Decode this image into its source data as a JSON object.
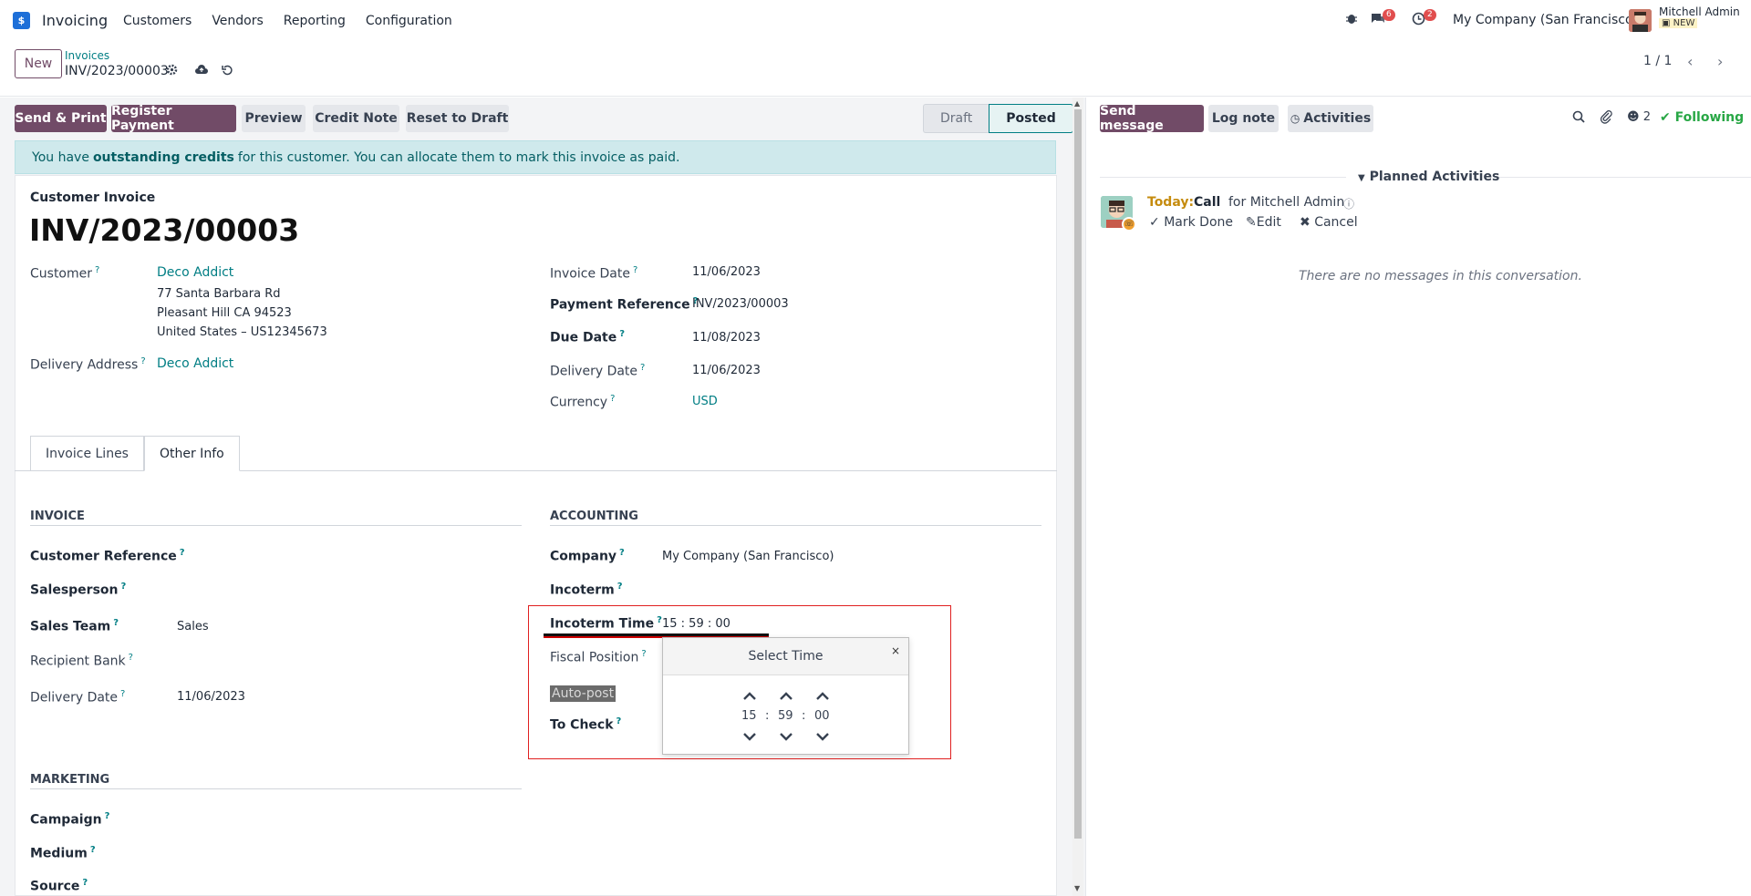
{
  "navbar": {
    "app_name": "Invoicing",
    "menu": [
      "Customers",
      "Vendors",
      "Reporting",
      "Configuration"
    ],
    "messages_count": "6",
    "activities_count": "2",
    "company": "My Company (San Francisco)",
    "user_name": "Mitchell Admin",
    "user_db": "NEW"
  },
  "control": {
    "new_label": "New",
    "breadcrumb": "Invoices",
    "record": "INV/2023/00003",
    "pager": "1 / 1"
  },
  "actions": {
    "send_print": "Send & Print",
    "register_payment": "Register Payment",
    "preview": "Preview",
    "credit_note": "Credit Note",
    "reset_draft": "Reset to Draft"
  },
  "status": {
    "draft": "Draft",
    "posted": "Posted"
  },
  "alert": {
    "pre": "You have",
    "bold": "outstanding credits",
    "post": "for this customer. You can allocate them to mark this invoice as paid."
  },
  "form": {
    "doc_type": "Customer Invoice",
    "number": "INV/2023/00003",
    "customer_label": "Customer",
    "customer": "Deco Addict",
    "address1": "77 Santa Barbara Rd",
    "address2": "Pleasant Hill CA 94523",
    "address3": "United States – US12345673",
    "delivery_address_label": "Delivery Address",
    "delivery_address": "Deco Addict",
    "invoice_date_label": "Invoice Date",
    "invoice_date": "11/06/2023",
    "payment_ref_label": "Payment Reference",
    "payment_ref": "INV/2023/00003",
    "due_date_label": "Due Date",
    "due_date": "11/08/2023",
    "delivery_date_label": "Delivery Date",
    "delivery_date": "11/06/2023",
    "currency_label": "Currency",
    "currency": "USD",
    "help": "?"
  },
  "tabs": [
    "Invoice Lines",
    "Other Info"
  ],
  "other_info": {
    "invoice_title": "INVOICE",
    "customer_reference": "Customer Reference",
    "salesperson": "Salesperson",
    "sales_team_label": "Sales Team",
    "sales_team": "Sales",
    "recipient_bank": "Recipient Bank",
    "delivery_date_label": "Delivery Date",
    "delivery_date": "11/06/2023",
    "accounting_title": "ACCOUNTING",
    "company_label": "Company",
    "company": "My Company (San Francisco)",
    "incoterm": "Incoterm",
    "incoterm_time_label": "Incoterm Time",
    "incoterm_time": "15 : 59 : 00",
    "fiscal_position": "Fiscal Position",
    "auto_post": "Auto-post",
    "to_check": "To Check",
    "marketing_title": "MARKETING",
    "campaign": "Campaign",
    "medium": "Medium",
    "source": "Source"
  },
  "timepicker": {
    "title": "Select Time",
    "close": "×",
    "hour": "15",
    "minute": "59",
    "second": "00",
    "sep": ":"
  },
  "chatter": {
    "send_message": "Send message",
    "log_note": "Log note",
    "activities": "Activities",
    "followers_count": "2",
    "following": "Following",
    "planned_title": "Planned Activities",
    "today": "Today:",
    "activity_type": "Call",
    "activity_for": "for Mitchell Admin",
    "mark_done": "Mark Done",
    "edit": "Edit",
    "cancel": "Cancel",
    "no_messages": "There are no messages in this conversation."
  },
  "colors": {
    "primary": "#714b67",
    "link": "#017e84",
    "badge": "#e14e4e",
    "highlight": "#e02020"
  }
}
